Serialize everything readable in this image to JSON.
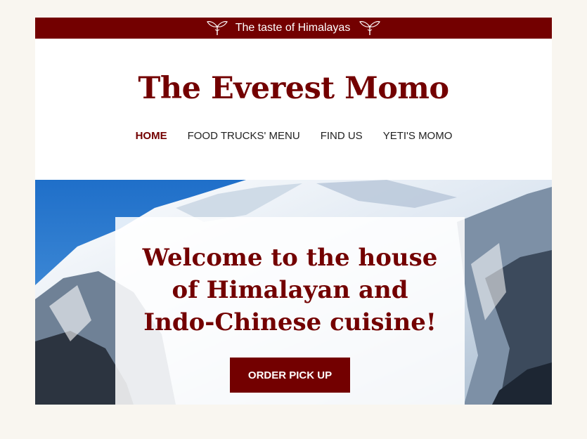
{
  "topbar": {
    "tagline": "The taste of Himalayas",
    "icon": "leaf-sprout-icon"
  },
  "brand": {
    "title": "The Everest Momo"
  },
  "nav": {
    "items": [
      {
        "label": "HOME",
        "active": true
      },
      {
        "label": "FOOD TRUCKS' MENU",
        "active": false
      },
      {
        "label": "FIND US",
        "active": false
      },
      {
        "label": "YETI'S MOMO",
        "active": false
      }
    ]
  },
  "hero": {
    "image": "snowy-mountain-image",
    "headline_lines": [
      "Welcome to the house",
      "of Himalayan and",
      "Indo-Chinese cuisine!"
    ],
    "cta_label": "ORDER PICK UP"
  },
  "colors": {
    "brand": "#730000",
    "page_bg": "#f9f6f0",
    "sky": "#2f7fd0"
  }
}
